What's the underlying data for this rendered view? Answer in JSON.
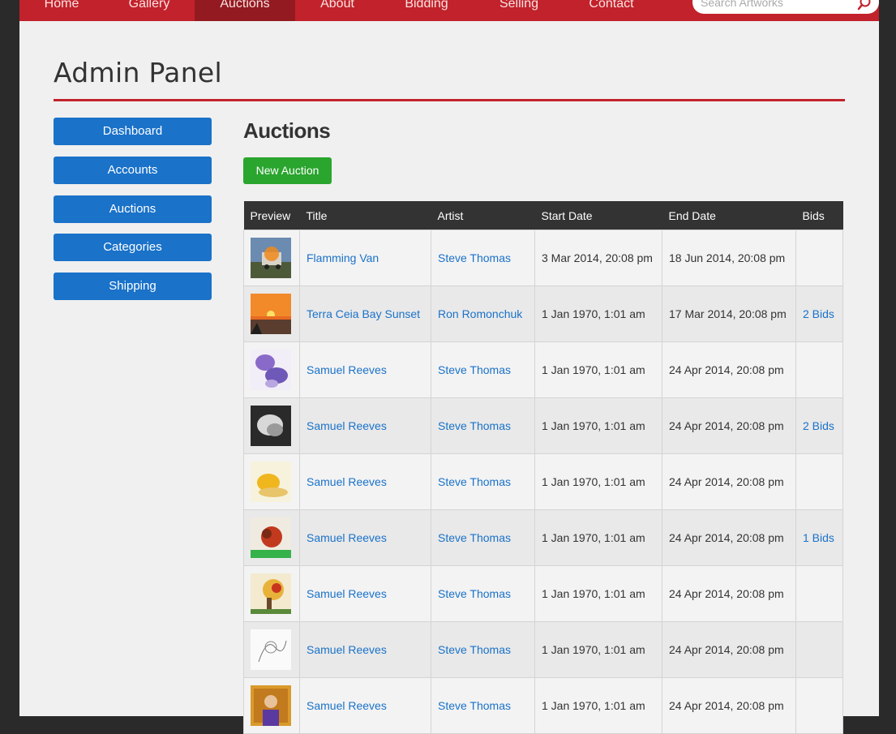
{
  "nav": {
    "items": [
      "Home",
      "Gallery",
      "Auctions",
      "About",
      "Bidding",
      "Selling",
      "Contact"
    ],
    "active": "Auctions",
    "search_placeholder": "Search Artworks"
  },
  "colors": {
    "brand_red": "#c2222b",
    "sidebar_blue": "#1a72c9",
    "new_green": "#2aa52e"
  },
  "page": {
    "title": "Admin Panel",
    "section_title": "Auctions",
    "new_button": "New Auction"
  },
  "sidebar": [
    "Dashboard",
    "Accounts",
    "Auctions",
    "Categories",
    "Shipping"
  ],
  "table": {
    "headers": [
      "Preview",
      "Title",
      "Artist",
      "Start Date",
      "End Date",
      "Bids"
    ],
    "rows": [
      {
        "title": "Flamming Van",
        "artist": "Steve Thomas",
        "start": "3 Mar 2014, 20:08 pm",
        "end": "18 Jun 2014, 20:08 pm",
        "bids": "",
        "thumb": "van"
      },
      {
        "title": "Terra Ceia Bay Sunset",
        "artist": "Ron Romonchuk",
        "start": "1 Jan 1970, 1:01 am",
        "end": "17 Mar 2014, 20:08 pm",
        "bids": "2 Bids",
        "thumb": "sunset"
      },
      {
        "title": "Samuel Reeves",
        "artist": "Steve Thomas",
        "start": "1 Jan 1970, 1:01 am",
        "end": "24 Apr 2014, 20:08 pm",
        "bids": "",
        "thumb": "purple"
      },
      {
        "title": "Samuel Reeves",
        "artist": "Steve Thomas",
        "start": "1 Jan 1970, 1:01 am",
        "end": "24 Apr 2014, 20:08 pm",
        "bids": "2 Bids",
        "thumb": "grey"
      },
      {
        "title": "Samuel Reeves",
        "artist": "Steve Thomas",
        "start": "1 Jan 1970, 1:01 am",
        "end": "24 Apr 2014, 20:08 pm",
        "bids": "",
        "thumb": "yellow"
      },
      {
        "title": "Samuel Reeves",
        "artist": "Steve Thomas",
        "start": "1 Jan 1970, 1:01 am",
        "end": "24 Apr 2014, 20:08 pm",
        "bids": "1 Bids",
        "thumb": "red-green"
      },
      {
        "title": "Samuel Reeves",
        "artist": "Steve Thomas",
        "start": "1 Jan 1970, 1:01 am",
        "end": "24 Apr 2014, 20:08 pm",
        "bids": "",
        "thumb": "tree"
      },
      {
        "title": "Samuel Reeves",
        "artist": "Steve Thomas",
        "start": "1 Jan 1970, 1:01 am",
        "end": "24 Apr 2014, 20:08 pm",
        "bids": "",
        "thumb": "sketch"
      },
      {
        "title": "Samuel Reeves",
        "artist": "Steve Thomas",
        "start": "1 Jan 1970, 1:01 am",
        "end": "24 Apr 2014, 20:08 pm",
        "bids": "",
        "thumb": "portrait"
      }
    ]
  }
}
